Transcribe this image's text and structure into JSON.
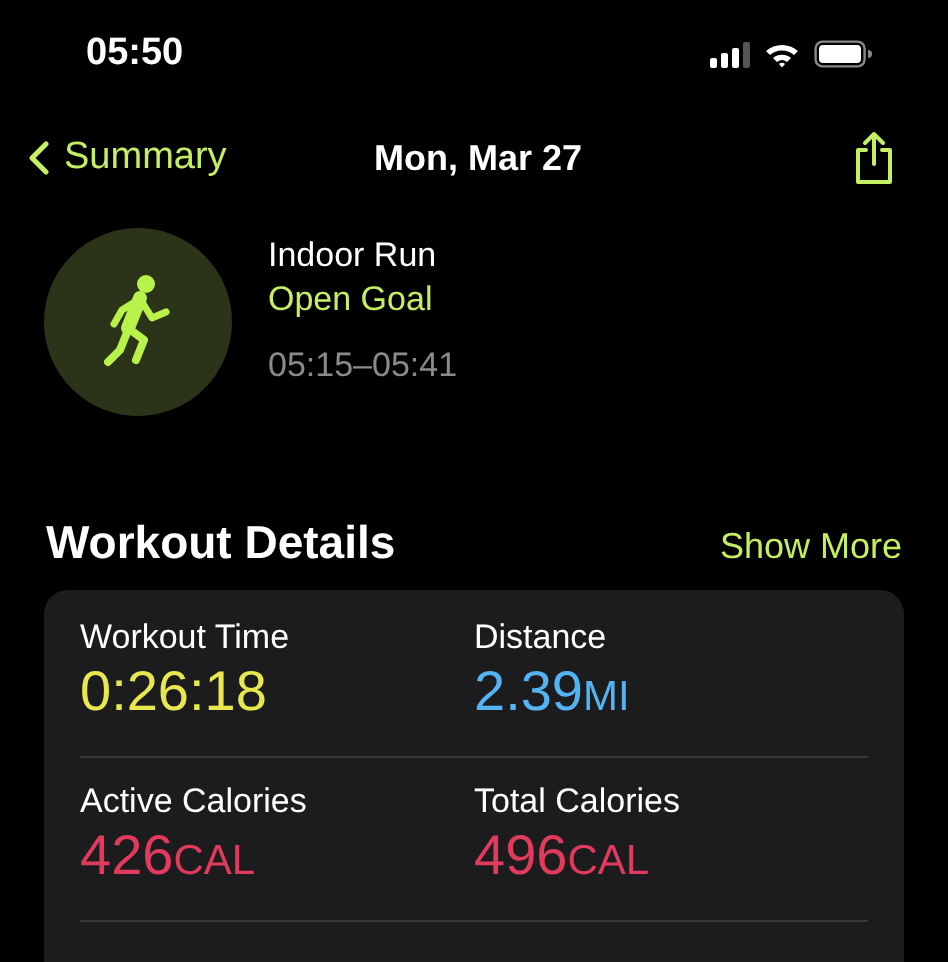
{
  "status_bar": {
    "time": "05:50"
  },
  "nav": {
    "back": "Summary",
    "title": "Mon, Mar 27"
  },
  "workout": {
    "name": "Indoor Run",
    "goal": "Open Goal",
    "time_range": "05:15–05:41"
  },
  "details": {
    "title": "Workout Details",
    "action": "Show More",
    "metrics": [
      {
        "label": "Workout Time",
        "value": "0:26:18",
        "color": "#e8e84e"
      },
      {
        "label": "Distance",
        "value": "2.39",
        "unit": "MI",
        "color": "#54b3f2"
      },
      {
        "label": "Active Calories",
        "value": "426",
        "unit": "CAL",
        "color": "#e23a5c"
      },
      {
        "label": "Total Calories",
        "value": "496",
        "unit": "CAL",
        "color": "#e23a5c"
      }
    ]
  }
}
